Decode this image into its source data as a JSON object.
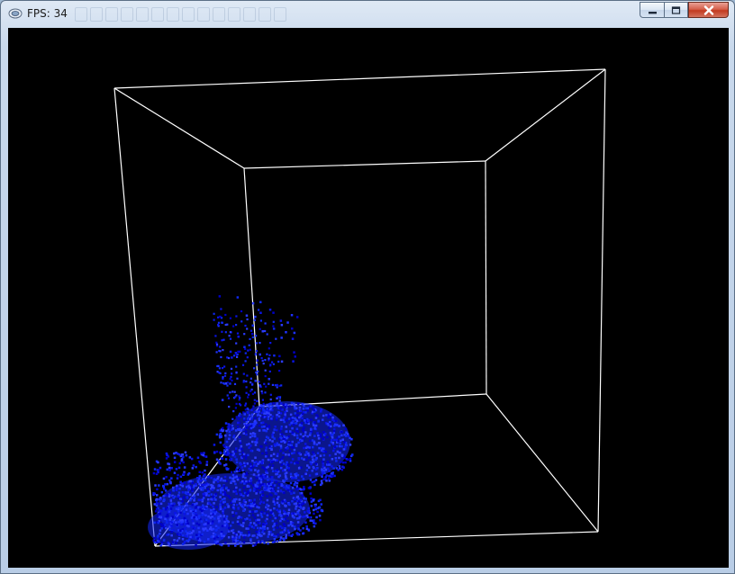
{
  "window": {
    "title": "FPS: 34"
  },
  "controls": {
    "minimize_icon": "minimize-icon",
    "maximize_icon": "maximize-icon",
    "close_icon": "close-icon"
  },
  "scene": {
    "background_color": "#000000",
    "box_color": "#ffffff",
    "particle_colors": [
      "#0000c8",
      "#0a14e6",
      "#1e32ff",
      "#0f28f0",
      "#2c3cff"
    ]
  }
}
